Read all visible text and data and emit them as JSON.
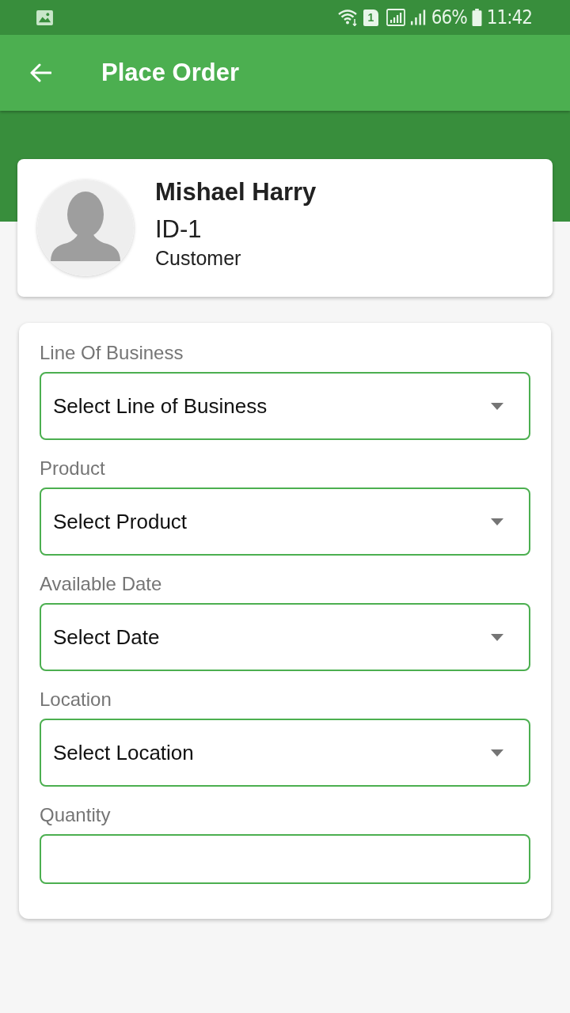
{
  "status_bar": {
    "sim_slot": "1",
    "battery": "66%",
    "time": "11:42"
  },
  "app_bar": {
    "title": "Place Order"
  },
  "customer": {
    "name": "Mishael Harry",
    "id": "ID-1",
    "role": "Customer"
  },
  "form": {
    "fields": [
      {
        "label": "Line Of Business",
        "kind": "dropdown",
        "value": "Select Line of Business"
      },
      {
        "label": "Product",
        "kind": "dropdown",
        "value": "Select Product"
      },
      {
        "label": "Available Date",
        "kind": "dropdown",
        "value": "Select Date"
      },
      {
        "label": "Location",
        "kind": "dropdown",
        "value": "Select Location"
      },
      {
        "label": "Quantity",
        "kind": "input"
      }
    ]
  }
}
